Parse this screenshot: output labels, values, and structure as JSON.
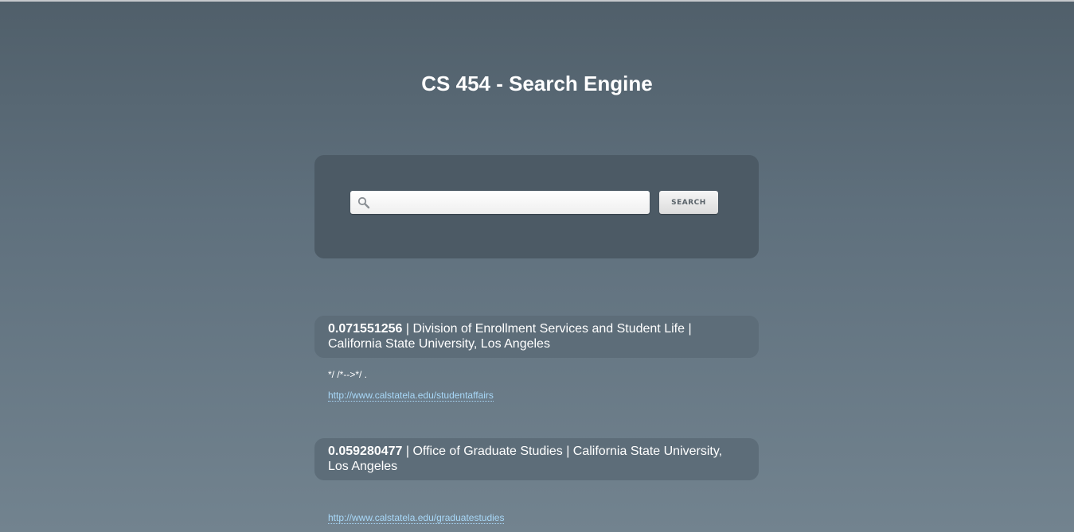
{
  "header": {
    "title": "CS 454 - Search Engine"
  },
  "search": {
    "value": "",
    "placeholder": "",
    "icon": "search-icon",
    "button_label": "SEARCH"
  },
  "results": [
    {
      "score": "0.071551256",
      "title": " | Division of Enrollment Services and Student Life | California State University, Los Angeles",
      "snippet": "*/ /*-->*/ .",
      "url": "http://www.calstatela.edu/studentaffairs"
    },
    {
      "score": "0.059280477",
      "title": " | Office of Graduate Studies | California State University, Los Angeles",
      "snippet": "",
      "url": "http://www.calstatela.edu/graduatestudies"
    }
  ],
  "colors": {
    "background_top": "#505f6a",
    "background_bottom": "#72838f",
    "panel": "#4c5a65",
    "result_header": "#5d6d79",
    "link": "#a8d8f8"
  }
}
